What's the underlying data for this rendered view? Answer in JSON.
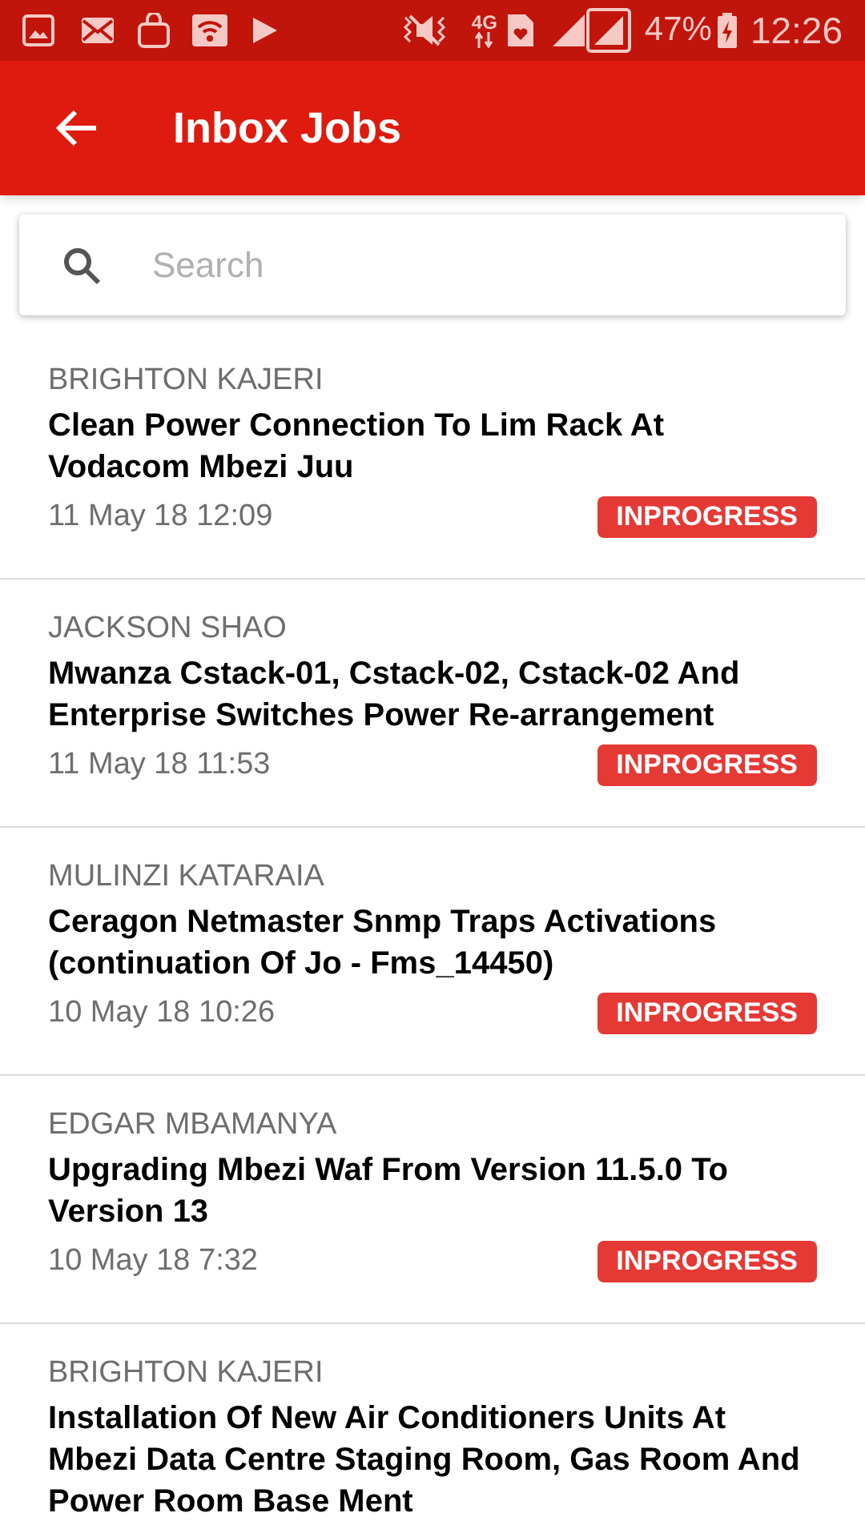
{
  "status_bar": {
    "network": "4G",
    "battery": "47%",
    "time": "12:26"
  },
  "app_bar": {
    "title": "Inbox Jobs"
  },
  "search": {
    "placeholder": "Search"
  },
  "jobs": [
    {
      "assignee": "BRIGHTON KAJERI",
      "title": "Clean Power Connection To Lim Rack At Vodacom Mbezi Juu",
      "date": "11 May 18 12:09",
      "status": "INPROGRESS"
    },
    {
      "assignee": "JACKSON SHAO",
      "title": "Mwanza Cstack-01, Cstack-02, Cstack-02 And Enterprise Switches Power Re-arrangement",
      "date": "11 May 18 11:53",
      "status": "INPROGRESS"
    },
    {
      "assignee": "MULINZI KATARAIA",
      "title": "Ceragon Netmaster Snmp Traps Activations (continuation Of Jo - Fms_14450)",
      "date": "10 May 18 10:26",
      "status": "INPROGRESS"
    },
    {
      "assignee": "EDGAR MBAMANYA",
      "title": "Upgrading Mbezi Waf From Version 11.5.0 To Version 13",
      "date": "10 May 18 7:32",
      "status": "INPROGRESS"
    },
    {
      "assignee": "BRIGHTON KAJERI",
      "title": "Installation Of New Air Conditioners Units At Mbezi Data Centre Staging Room, Gas Room And Power Room Base Ment"
    }
  ]
}
